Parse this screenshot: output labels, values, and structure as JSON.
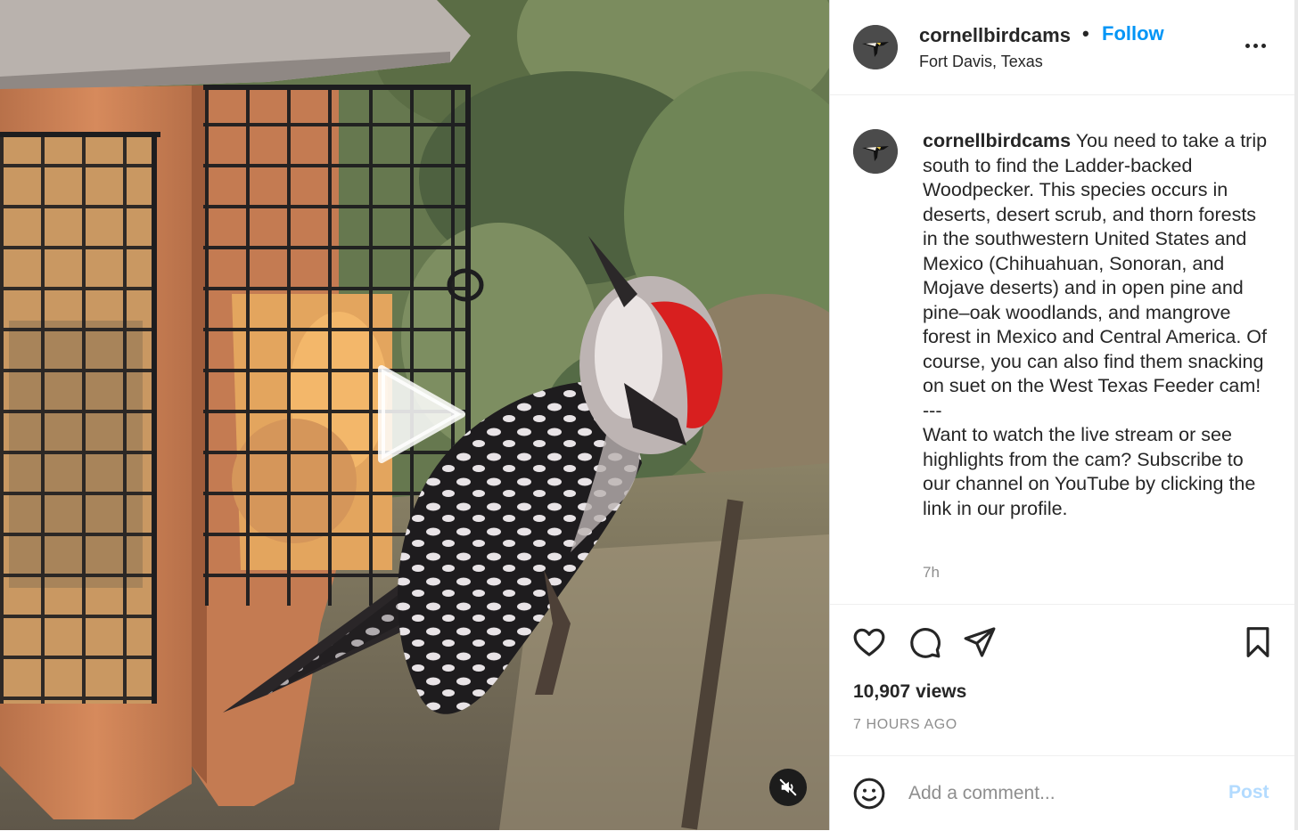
{
  "post": {
    "username": "cornellbirdcams",
    "separator": "•",
    "follow_label": "Follow",
    "location": "Fort Davis, Texas",
    "caption": "You need to take a trip south to find the Ladder-backed Woodpecker. This species occurs in deserts, desert scrub, and thorn forests in the southwestern United States and Mexico (Chihuahuan, Sonoran, and Mojave deserts) and in open pine and pine–oak woodlands, and mangrove forest in Mexico and Central America. Of course, you can also find them snacking on suet on the West Texas Feeder cam!\n---\nWant to watch the live stream or see highlights from the cam? Subscribe to our channel on YouTube by clicking the link in our profile.",
    "time_ago": "7h",
    "views": "10,907 views",
    "post_age": "7 HOURS AGO"
  },
  "comment": {
    "placeholder": "Add a comment...",
    "post_label": "Post"
  },
  "icons": {
    "play": "play-icon",
    "mute": "muted-speaker-icon",
    "more": "more-options-icon",
    "like": "heart-icon",
    "comment": "comment-bubble-icon",
    "share": "paper-plane-icon",
    "save": "bookmark-icon",
    "emoji": "smiley-icon"
  },
  "colors": {
    "accent": "#0095f6",
    "post_disabled": "#b3dbff",
    "text": "#262626",
    "muted": "#8e8e8e",
    "border": "#efefef"
  }
}
